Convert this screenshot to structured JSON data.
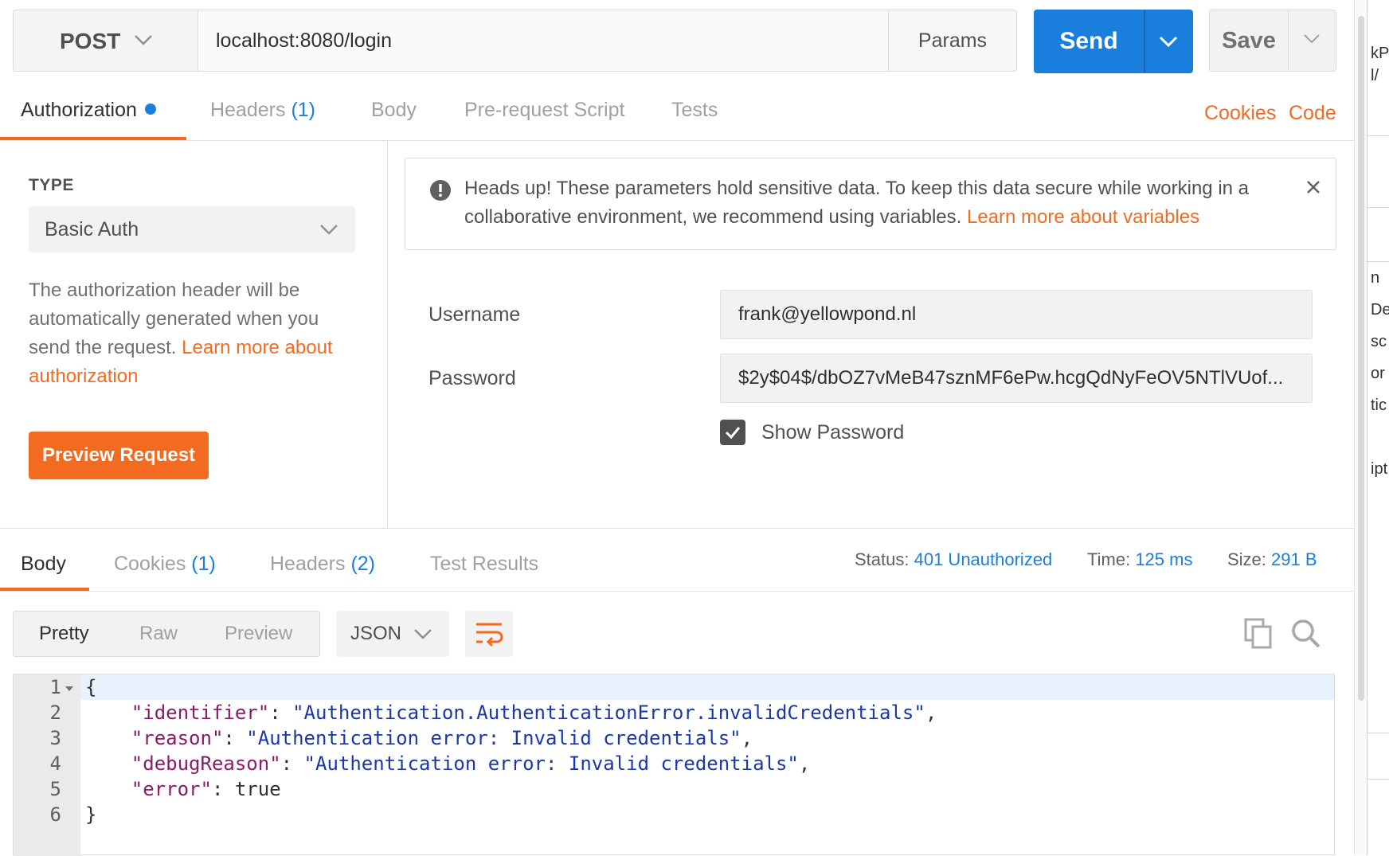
{
  "request": {
    "method": "POST",
    "url": "localhost:8080/login",
    "params_label": "Params",
    "send_label": "Send",
    "save_label": "Save"
  },
  "request_tabs": {
    "authorization": "Authorization",
    "headers": "Headers",
    "headers_count": "(1)",
    "body": "Body",
    "prerequest": "Pre-request Script",
    "tests": "Tests",
    "cookies": "Cookies",
    "code": "Code"
  },
  "auth": {
    "type_label": "TYPE",
    "type_value": "Basic Auth",
    "description": "The authorization header will be automatically generated when you send the request. ",
    "learn_more": "Learn more about authorization",
    "preview_button": "Preview Request",
    "warning_text": "Heads up! These parameters hold sensitive data. To keep this data secure while working in a collaborative environment, we recommend using variables. ",
    "warning_link": "Learn more about variables",
    "username_label": "Username",
    "username_value": "frank@yellowpond.nl",
    "password_label": "Password",
    "password_value": "$2y$04$/dbOZ7vMeB47sznMF6ePw.hcgQdNyFeOV5NTlVUof...",
    "show_password_label": "Show Password",
    "show_password_checked": true
  },
  "response_tabs": {
    "body": "Body",
    "cookies": "Cookies",
    "cookies_count": "(1)",
    "headers": "Headers",
    "headers_count": "(2)",
    "test_results": "Test Results"
  },
  "response_meta": {
    "status_label": "Status:",
    "status_value": "401 Unauthorized",
    "time_label": "Time:",
    "time_value": "125 ms",
    "size_label": "Size:",
    "size_value": "291 B"
  },
  "view": {
    "pretty": "Pretty",
    "raw": "Raw",
    "preview": "Preview",
    "format": "JSON"
  },
  "response_body": {
    "line_numbers": [
      "1",
      "2",
      "3",
      "4",
      "5",
      "6"
    ],
    "open_brace": "{",
    "close_brace": "}",
    "identifier_key": "\"identifier\"",
    "identifier_value": "\"Authentication.AuthenticationError.invalidCredentials\"",
    "reason_key": "\"reason\"",
    "reason_value": "\"Authentication error: Invalid credentials\"",
    "debug_key": "\"debugReason\"",
    "debug_value": "\"Authentication error: Invalid credentials\"",
    "error_key": "\"error\"",
    "error_value": "true"
  },
  "side_window": {
    "fragments": [
      "kP",
      "l/",
      "n",
      "De",
      "sc",
      "or",
      "tic",
      "ipt"
    ]
  },
  "colors": {
    "accent_orange": "#f26b21",
    "accent_blue": "#1a7fdc"
  }
}
